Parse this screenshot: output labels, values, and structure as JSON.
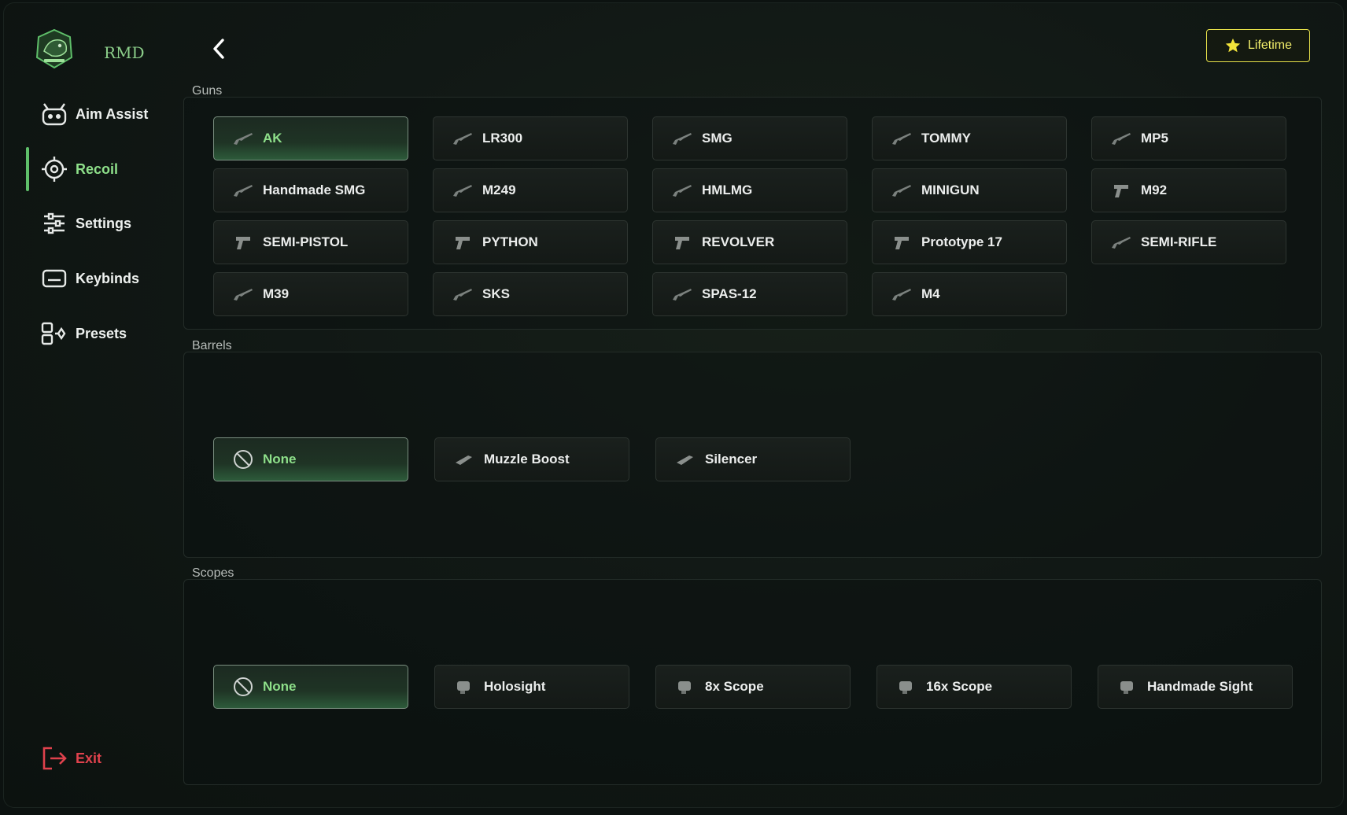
{
  "app": {
    "brand": "RMD"
  },
  "colors": {
    "accent": "#8ee08a",
    "exit": "#e0424d",
    "lifetime": "#f2ee6a"
  },
  "sidebar": {
    "items": [
      {
        "label": "Aim Assist",
        "icon": "robot-icon"
      },
      {
        "label": "Recoil",
        "icon": "crosshair-icon",
        "active": true
      },
      {
        "label": "Settings",
        "icon": "sliders-icon"
      },
      {
        "label": "Keybinds",
        "icon": "keyboard-icon"
      },
      {
        "label": "Presets",
        "icon": "presets-icon"
      }
    ],
    "exit_label": "Exit"
  },
  "header": {
    "lifetime_label": "Lifetime"
  },
  "sections": {
    "guns": {
      "title": "Guns",
      "selected": "AK",
      "items": [
        "AK",
        "LR300",
        "SMG",
        "TOMMY",
        "MP5",
        "Handmade SMG",
        "M249",
        "HMLMG",
        "MINIGUN",
        "M92",
        "SEMI-PISTOL",
        "PYTHON",
        "REVOLVER",
        "Prototype 17",
        "SEMI-RIFLE",
        "M39",
        "SKS",
        "SPAS-12",
        "M4"
      ]
    },
    "barrels": {
      "title": "Barrels",
      "selected": "None",
      "items": [
        "None",
        "Muzzle Boost",
        "Silencer"
      ]
    },
    "scopes": {
      "title": "Scopes",
      "selected": "None",
      "items": [
        "None",
        "Holosight",
        "8x Scope",
        "16x Scope",
        "Handmade Sight"
      ]
    }
  }
}
